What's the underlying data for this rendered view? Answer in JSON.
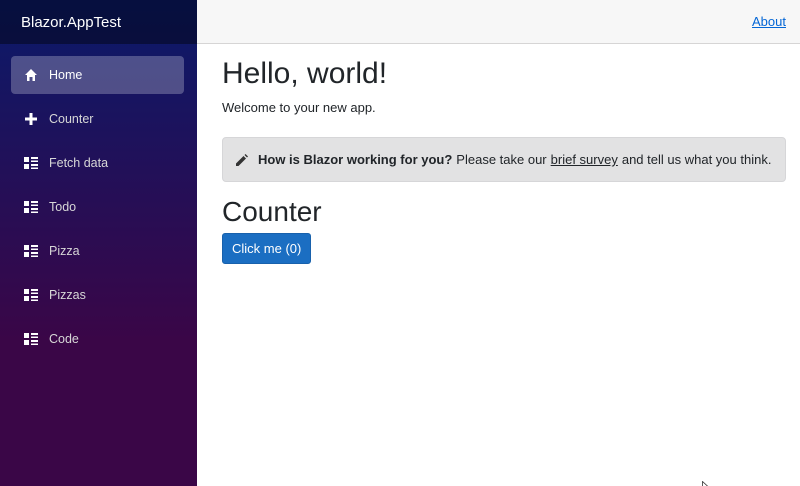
{
  "brand": "Blazor.AppTest",
  "nav": [
    {
      "label": "Home",
      "icon": "home-icon",
      "active": true
    },
    {
      "label": "Counter",
      "icon": "plus-icon"
    },
    {
      "label": "Fetch data",
      "icon": "list-rich-icon"
    },
    {
      "label": "Todo",
      "icon": "list-rich-icon"
    },
    {
      "label": "Pizza",
      "icon": "list-rich-icon"
    },
    {
      "label": "Pizzas",
      "icon": "list-rich-icon"
    },
    {
      "label": "Code",
      "icon": "list-rich-icon"
    }
  ],
  "topbar": {
    "about": "About"
  },
  "main": {
    "title": "Hello, world!",
    "welcome": "Welcome to your new app.",
    "survey": {
      "question": "How is Blazor working for you?",
      "pre_link": "Please take our",
      "link": "brief survey",
      "post_link": "and tell us what you think."
    },
    "counter_title": "Counter",
    "counter_button": "Click me (0)"
  },
  "colors": {
    "accent": "#1b6ec2",
    "link": "#0366d6",
    "sidebar_top": "#0a1a6a",
    "sidebar_bottom": "#3a0647"
  }
}
